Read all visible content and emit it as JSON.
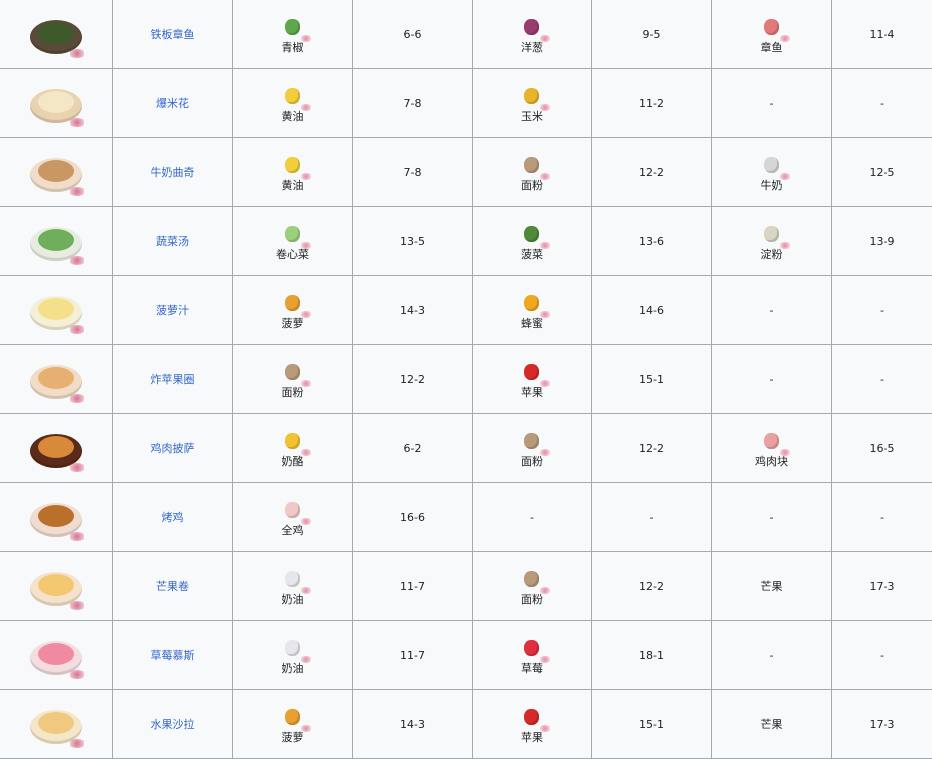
{
  "rows": [
    {
      "dish": "铁板章鱼",
      "plate": "#5a4a3a",
      "food": "#3e5a2a",
      "ing": [
        {
          "name": "青椒",
          "color": "#5fa84a",
          "icon": "green-pepper-icon"
        },
        {
          "name": "洋葱",
          "color": "#9a3d6e",
          "icon": "onion-icon"
        },
        {
          "name": "章鱼",
          "color": "#e07a7a",
          "icon": "octopus-icon"
        }
      ],
      "codes": [
        "6-6",
        "9-5",
        "11-4"
      ]
    },
    {
      "dish": "爆米花",
      "plate": "#e9d2b0",
      "food": "#f4e7c6",
      "ing": [
        {
          "name": "黄油",
          "color": "#f2cf3a",
          "icon": "butter-icon"
        },
        {
          "name": "玉米",
          "color": "#e8b52a",
          "icon": "corn-icon"
        },
        {
          "name": "-",
          "color": "",
          "icon": ""
        }
      ],
      "codes": [
        "7-8",
        "11-2",
        "-"
      ]
    },
    {
      "dish": "牛奶曲奇",
      "plate": "#f0dcc8",
      "food": "#c99763",
      "ing": [
        {
          "name": "黄油",
          "color": "#f2cf3a",
          "icon": "butter-icon"
        },
        {
          "name": "面粉",
          "color": "#b89a7a",
          "icon": "flour-sack-icon"
        },
        {
          "name": "牛奶",
          "color": "#d6d6d6",
          "icon": "milk-carton-icon"
        }
      ],
      "codes": [
        "7-8",
        "12-2",
        "12-5"
      ]
    },
    {
      "dish": "蔬菜汤",
      "plate": "#e8ece0",
      "food": "#6fae5a",
      "ing": [
        {
          "name": "卷心菜",
          "color": "#9ccf7a",
          "icon": "cabbage-icon"
        },
        {
          "name": "菠菜",
          "color": "#4f8a3a",
          "icon": "spinach-icon"
        },
        {
          "name": "淀粉",
          "color": "#d9d4c4",
          "icon": "starch-bowl-icon"
        }
      ],
      "codes": [
        "13-5",
        "13-6",
        "13-9"
      ]
    },
    {
      "dish": "菠萝汁",
      "plate": "#f4efd6",
      "food": "#f4e08a",
      "ing": [
        {
          "name": "菠萝",
          "color": "#e8a030",
          "icon": "pineapple-icon"
        },
        {
          "name": "蜂蜜",
          "color": "#f0a820",
          "icon": "honey-jar-icon"
        },
        {
          "name": "-",
          "color": "",
          "icon": ""
        }
      ],
      "codes": [
        "14-3",
        "14-6",
        "-"
      ]
    },
    {
      "dish": "炸苹果圈",
      "plate": "#f1dcc8",
      "food": "#e8b070",
      "ing": [
        {
          "name": "面粉",
          "color": "#b89a7a",
          "icon": "flour-sack-icon"
        },
        {
          "name": "苹果",
          "color": "#d62a2a",
          "icon": "apple-icon"
        },
        {
          "name": "-",
          "color": "",
          "icon": ""
        }
      ],
      "codes": [
        "12-2",
        "15-1",
        "-"
      ]
    },
    {
      "dish": "鸡肉披萨",
      "plate": "#5a2a1a",
      "food": "#d88a3a",
      "ing": [
        {
          "name": "奶酪",
          "color": "#f2c230",
          "icon": "cheese-icon"
        },
        {
          "name": "面粉",
          "color": "#b89a7a",
          "icon": "flour-sack-icon"
        },
        {
          "name": "鸡肉块",
          "color": "#e8a0a0",
          "icon": "chicken-chunks-icon"
        }
      ],
      "codes": [
        "6-2",
        "12-2",
        "16-5"
      ]
    },
    {
      "dish": "烤鸡",
      "plate": "#f0dcd0",
      "food": "#b8702a",
      "ing": [
        {
          "name": "全鸡",
          "color": "#f0c8c8",
          "icon": "whole-chicken-icon"
        },
        {
          "name": "-",
          "color": "",
          "icon": ""
        },
        {
          "name": "-",
          "color": "",
          "icon": ""
        }
      ],
      "codes": [
        "16-6",
        "-",
        "-"
      ]
    },
    {
      "dish": "芒果卷",
      "plate": "#f4e2cc",
      "food": "#f4c870",
      "ing": [
        {
          "name": "奶油",
          "color": "#e6e6ec",
          "icon": "cream-icon"
        },
        {
          "name": "面粉",
          "color": "#b89a7a",
          "icon": "flour-sack-icon"
        },
        {
          "name": "芒果",
          "color": "",
          "icon": ""
        }
      ],
      "codes": [
        "11-7",
        "12-2",
        "17-3"
      ]
    },
    {
      "dish": "草莓慕斯",
      "plate": "#f4dde0",
      "food": "#f08aa0",
      "ing": [
        {
          "name": "奶油",
          "color": "#e6e6ec",
          "icon": "cream-icon"
        },
        {
          "name": "草莓",
          "color": "#e03040",
          "icon": "strawberry-icon"
        },
        {
          "name": "-",
          "color": "",
          "icon": ""
        }
      ],
      "codes": [
        "11-7",
        "18-1",
        "-"
      ]
    },
    {
      "dish": "水果沙拉",
      "plate": "#f4e6c8",
      "food": "#f0c880",
      "ing": [
        {
          "name": "菠萝",
          "color": "#e8a030",
          "icon": "pineapple-icon"
        },
        {
          "name": "苹果",
          "color": "#d62a2a",
          "icon": "apple-icon"
        },
        {
          "name": "芒果",
          "color": "",
          "icon": ""
        }
      ],
      "codes": [
        "14-3",
        "15-1",
        "17-3"
      ]
    }
  ]
}
